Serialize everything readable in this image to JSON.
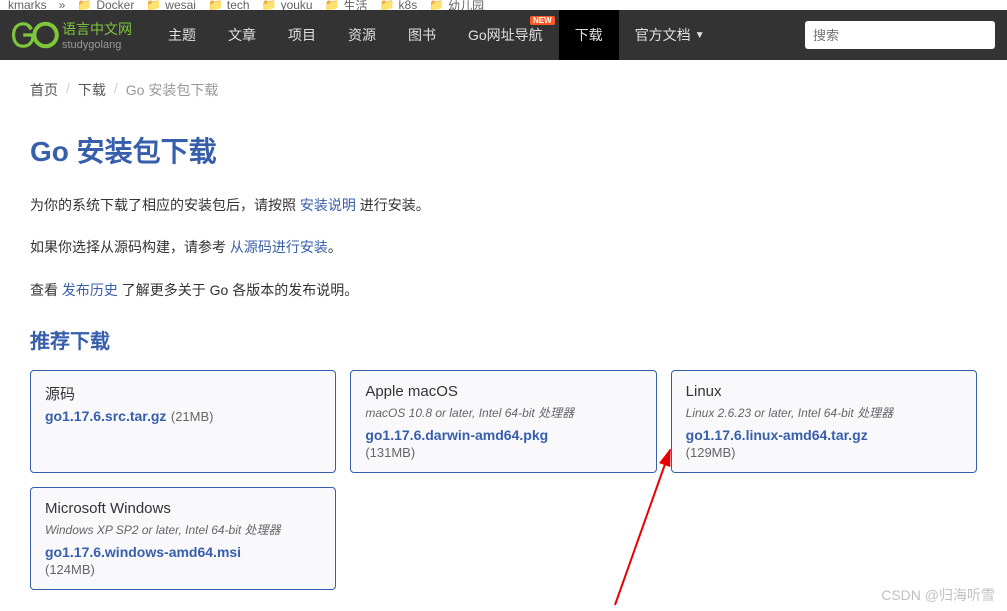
{
  "bookmarks": {
    "items": [
      "kmarks",
      "Docker",
      "wesai",
      "tech",
      "youku",
      "生活",
      "k8s",
      "幼儿园"
    ]
  },
  "logo": {
    "title": "语言中文网",
    "subtitle": "studygolang"
  },
  "nav": {
    "items": [
      {
        "label": "主题"
      },
      {
        "label": "文章"
      },
      {
        "label": "项目"
      },
      {
        "label": "资源"
      },
      {
        "label": "图书"
      },
      {
        "label": "Go网址导航",
        "badge": "NEW"
      },
      {
        "label": "下载",
        "active": true
      },
      {
        "label": "官方文档",
        "dropdown": true
      }
    ]
  },
  "search": {
    "placeholder": "搜索"
  },
  "breadcrumb": {
    "home": "首页",
    "download": "下载",
    "current": "Go 安装包下载"
  },
  "page": {
    "title": "Go 安装包下载",
    "intro1_pre": "为你的系统下载了相应的安装包后，请按照 ",
    "intro1_link": "安装说明",
    "intro1_post": " 进行安装。",
    "intro2_pre": "如果你选择从源码构建，请参考 ",
    "intro2_link": "从源码进行安装",
    "intro2_post": "。",
    "intro3_pre": "查看 ",
    "intro3_link": "发布历史",
    "intro3_post": " 了解更多关于 Go 各版本的发布说明。",
    "recommended_title": "推荐下载"
  },
  "downloads": [
    {
      "os": "源码",
      "requirements": "",
      "file": "go1.17.6.src.tar.gz",
      "size": "(21MB)"
    },
    {
      "os": "Apple macOS",
      "requirements": "macOS 10.8 or later, Intel 64-bit 处理器",
      "file": "go1.17.6.darwin-amd64.pkg",
      "size": "(131MB)"
    },
    {
      "os": "Linux",
      "requirements": "Linux 2.6.23 or later, Intel 64-bit 处理器",
      "file": "go1.17.6.linux-amd64.tar.gz",
      "size": "(129MB)"
    },
    {
      "os": "Microsoft Windows",
      "requirements": "Windows XP SP2 or later, Intel 64-bit 处理器",
      "file": "go1.17.6.windows-amd64.msi",
      "size": "(124MB)"
    }
  ],
  "watermark": "CSDN @归海听雪"
}
